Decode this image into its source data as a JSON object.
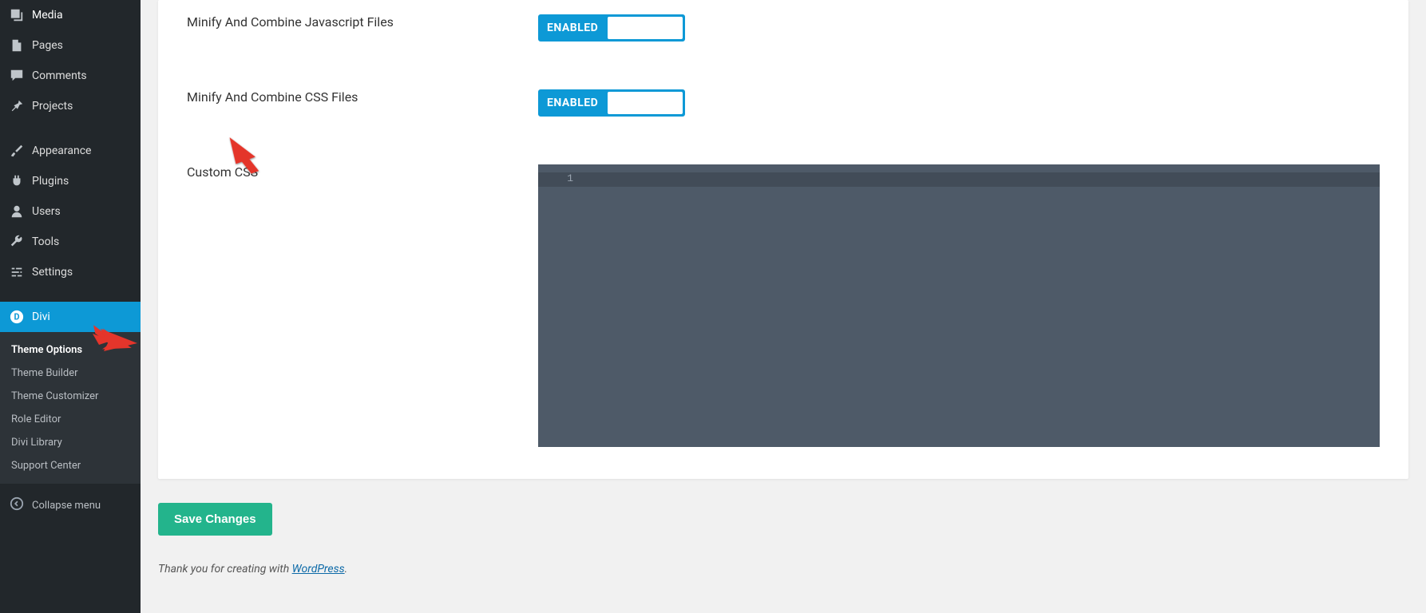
{
  "sidebar": {
    "primary": [
      {
        "label": "Media",
        "name": "sidebar-item-media",
        "icon": "media-icon"
      },
      {
        "label": "Pages",
        "name": "sidebar-item-pages",
        "icon": "page-icon"
      },
      {
        "label": "Comments",
        "name": "sidebar-item-comments",
        "icon": "comment-icon"
      },
      {
        "label": "Projects",
        "name": "sidebar-item-projects",
        "icon": "pin-icon"
      }
    ],
    "secondary": [
      {
        "label": "Appearance",
        "name": "sidebar-item-appearance",
        "icon": "brush-icon"
      },
      {
        "label": "Plugins",
        "name": "sidebar-item-plugins",
        "icon": "plug-icon"
      },
      {
        "label": "Users",
        "name": "sidebar-item-users",
        "icon": "user-icon"
      },
      {
        "label": "Tools",
        "name": "sidebar-item-tools",
        "icon": "wrench-icon"
      },
      {
        "label": "Settings",
        "name": "sidebar-item-settings",
        "icon": "sliders-icon"
      }
    ],
    "active": {
      "label": "Divi",
      "name": "sidebar-item-divi",
      "icon": "divi-icon"
    },
    "subitems": [
      {
        "label": "Theme Options",
        "name": "subitem-theme-options",
        "current": true
      },
      {
        "label": "Theme Builder",
        "name": "subitem-theme-builder",
        "current": false
      },
      {
        "label": "Theme Customizer",
        "name": "subitem-theme-customizer",
        "current": false
      },
      {
        "label": "Role Editor",
        "name": "subitem-role-editor",
        "current": false
      },
      {
        "label": "Divi Library",
        "name": "subitem-divi-library",
        "current": false
      },
      {
        "label": "Support Center",
        "name": "subitem-support-center",
        "current": false
      }
    ],
    "collapse_label": "Collapse menu"
  },
  "options": {
    "minify_js_label": "Minify And Combine Javascript Files",
    "minify_css_label": "Minify And Combine CSS Files",
    "custom_css_label": "Custom CSS",
    "toggle_enabled_label": "ENABLED"
  },
  "code": {
    "line1_number": "1",
    "line1_content": ""
  },
  "actions": {
    "save_label": "Save Changes"
  },
  "footer": {
    "prefix": "Thank you for creating with ",
    "link_text": "WordPress",
    "suffix": "."
  },
  "colors": {
    "accent_teal": "#23b48c",
    "accent_blue": "#0d99d6",
    "sidebar_bg": "#22272b",
    "code_bg": "#4e5a68"
  }
}
